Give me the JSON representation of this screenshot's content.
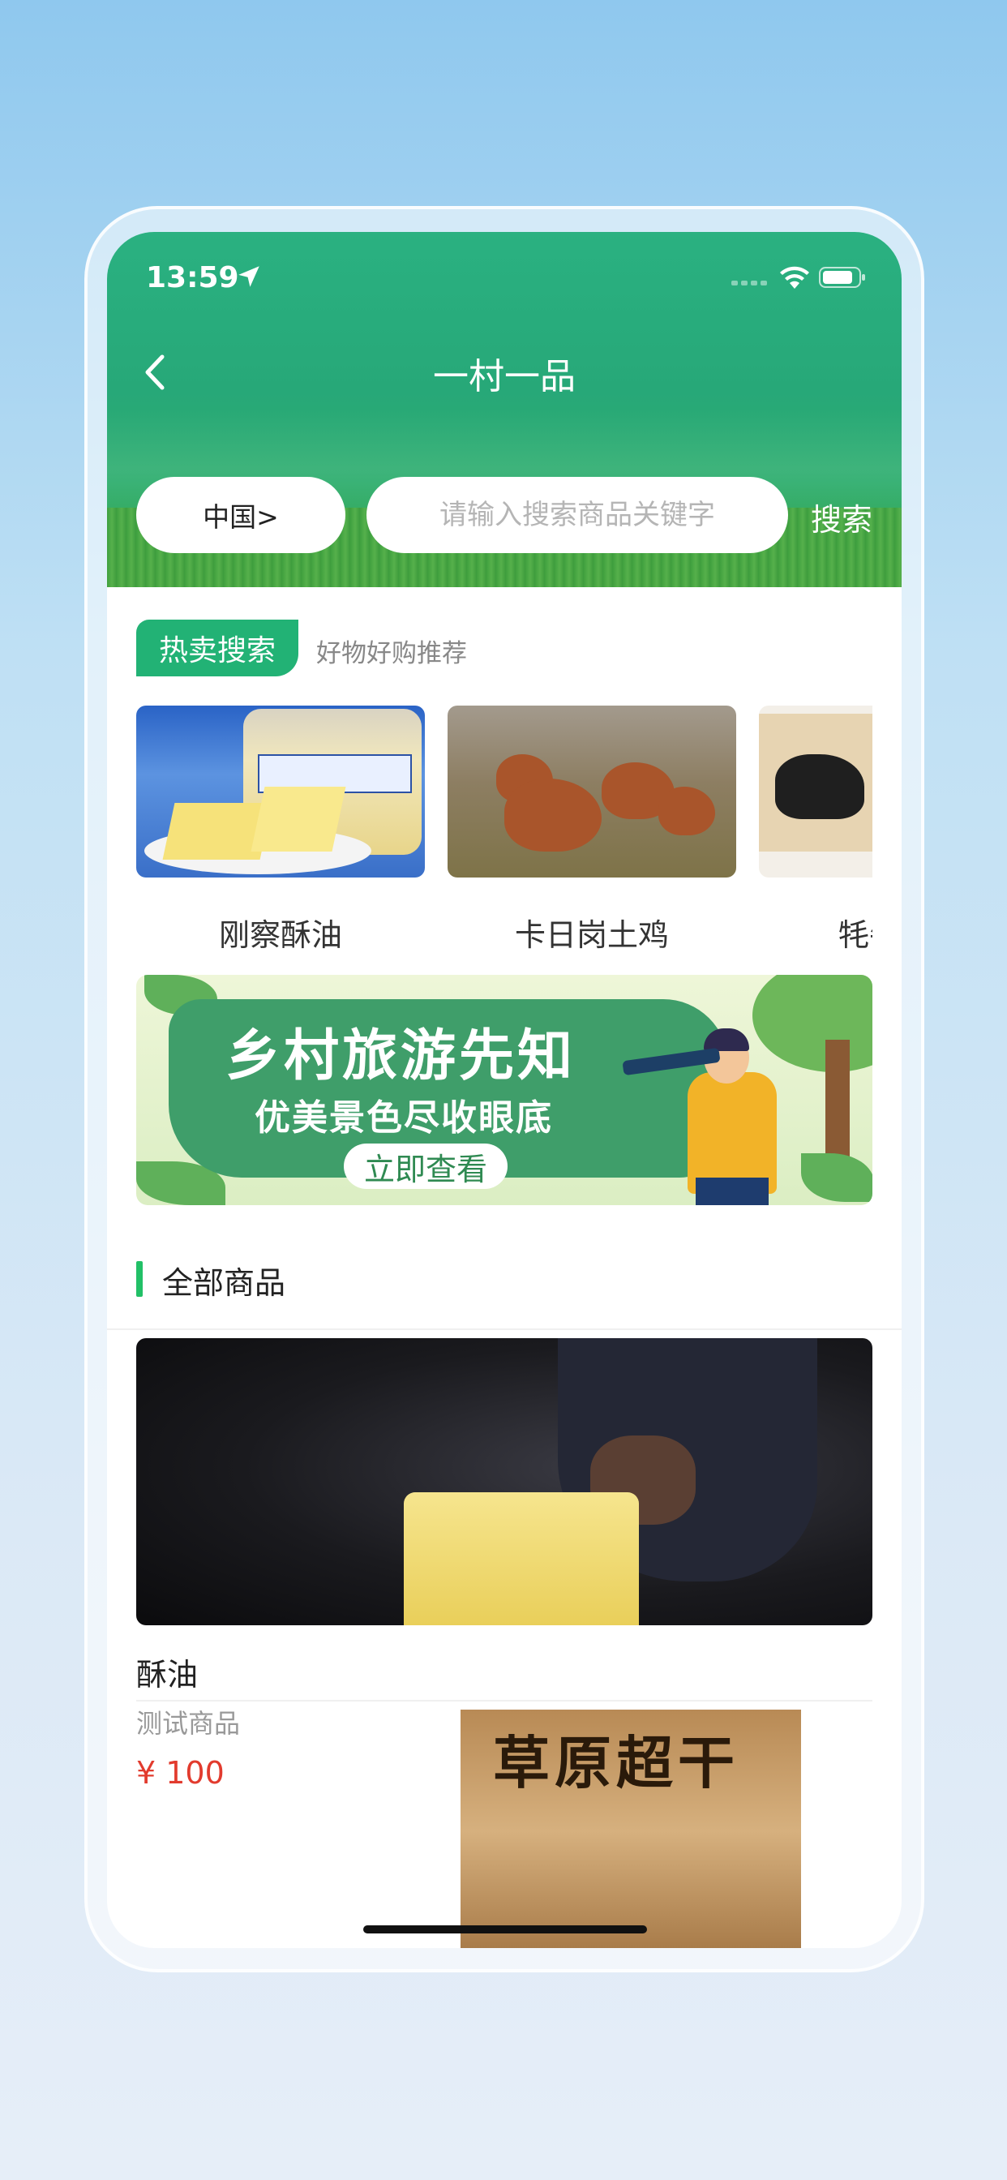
{
  "status_bar": {
    "time": "13:59",
    "icons": [
      "location-arrow-icon",
      "signal-icon",
      "wifi-icon",
      "battery-icon"
    ]
  },
  "nav": {
    "title": "一村一品",
    "back_icon": "chevron-left-icon"
  },
  "search": {
    "region": "中国>",
    "placeholder": "请输入搜索商品关键字",
    "button": "搜索"
  },
  "hot": {
    "tag": "热卖搜索",
    "subtitle": "好物好购推荐",
    "items": [
      {
        "name": "刚察酥油"
      },
      {
        "name": "卡日岗土鸡"
      },
      {
        "name": "牦牛"
      }
    ]
  },
  "banner": {
    "title": "乡村旅游先知",
    "subtitle": "优美景色尽收眼底",
    "button": "立即查看"
  },
  "all_products": {
    "title": "全部商品",
    "items": [
      {
        "name": "酥油",
        "desc": "测试商品",
        "price": "¥ 100"
      },
      {
        "image_text": "草原超干"
      }
    ]
  },
  "colors": {
    "header_green": "#27a878",
    "accent_green": "#22b275",
    "price_red": "#e23b2e"
  }
}
